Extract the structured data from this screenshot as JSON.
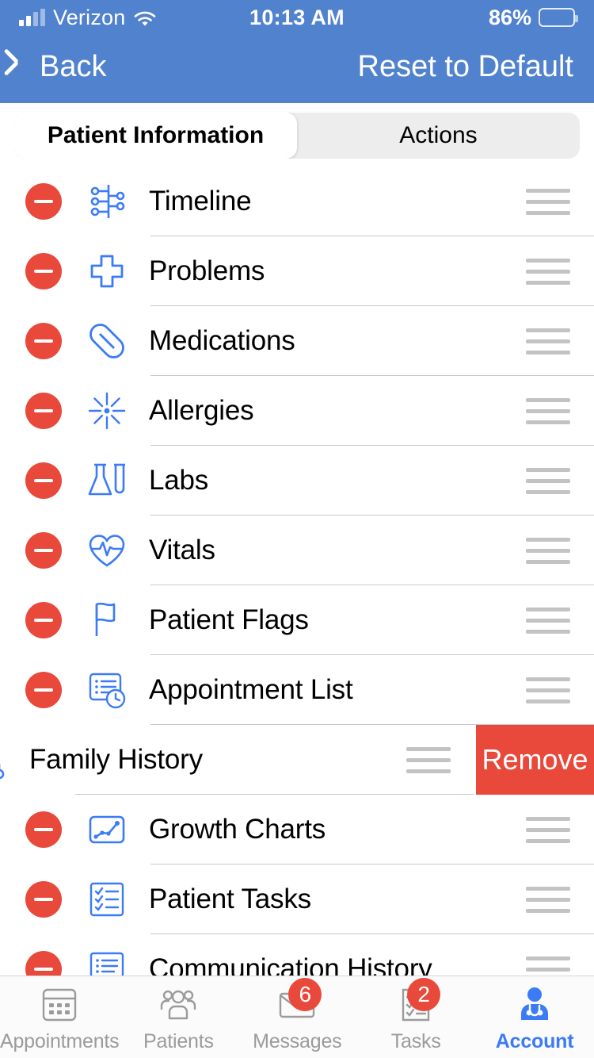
{
  "status_bar": {
    "carrier": "Verizon",
    "time": "10:13 AM",
    "battery_percent": "86%",
    "wifi_icon": "wifi-icon",
    "signal_icon": "cellular-signal-icon",
    "battery_icon": "battery-icon"
  },
  "nav": {
    "back_label": "Back",
    "back_icon": "chevron-left-icon",
    "action_label": "Reset to Default",
    "background_color": "#5182CE"
  },
  "segmented_control": {
    "options": [
      {
        "label": "Patient Information",
        "selected": true
      },
      {
        "label": "Actions",
        "selected": false
      }
    ]
  },
  "list": {
    "remove_icon": "minus-circle-icon",
    "drag_handle_icon": "drag-handle-icon",
    "accent_red": "#E8493B",
    "accent_blue": "#3B7BF5",
    "items": [
      {
        "label": "Timeline",
        "icon": "timeline-icon",
        "swiped": false
      },
      {
        "label": "Problems",
        "icon": "medical-cross-icon",
        "swiped": false
      },
      {
        "label": "Medications",
        "icon": "pill-capsule-icon",
        "swiped": false
      },
      {
        "label": "Allergies",
        "icon": "allergen-burst-icon",
        "swiped": false
      },
      {
        "label": "Labs",
        "icon": "lab-flask-icon",
        "swiped": false
      },
      {
        "label": "Vitals",
        "icon": "heart-pulse-icon",
        "swiped": false
      },
      {
        "label": "Patient Flags",
        "icon": "flag-icon",
        "swiped": false
      },
      {
        "label": "Appointment List",
        "icon": "appointment-list-icon",
        "swiped": false
      },
      {
        "label": "Family History",
        "icon": "family-history-icon",
        "swiped": true,
        "swipe_action_label": "Remove"
      },
      {
        "label": "Growth Charts",
        "icon": "growth-chart-icon",
        "swiped": false
      },
      {
        "label": "Patient Tasks",
        "icon": "task-checklist-icon",
        "swiped": false
      },
      {
        "label": "Communication History",
        "icon": "chat-list-icon",
        "swiped": false
      }
    ]
  },
  "tab_bar": {
    "tabs": [
      {
        "label": "Appointments",
        "icon": "calendar-icon",
        "active": false,
        "badge": ""
      },
      {
        "label": "Patients",
        "icon": "people-group-icon",
        "active": false,
        "badge": ""
      },
      {
        "label": "Messages",
        "icon": "envelope-icon",
        "active": false,
        "badge": "6"
      },
      {
        "label": "Tasks",
        "icon": "checklist-icon",
        "active": false,
        "badge": "2"
      },
      {
        "label": "Account",
        "icon": "doctor-account-icon",
        "active": true,
        "badge": ""
      }
    ]
  }
}
